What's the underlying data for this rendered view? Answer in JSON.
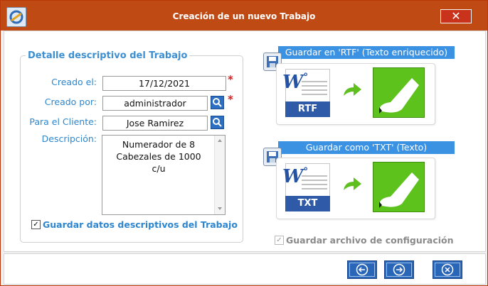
{
  "window": {
    "title": "Creación de un nuevo Trabajo",
    "close_glyph": "✕"
  },
  "details": {
    "legend": "Detalle descriptivo del Trabajo",
    "created_on_label": "Creado el:",
    "created_on_value": "17/12/2021",
    "created_by_label": "Creado por:",
    "created_by_value": "administrador",
    "client_label": "Para el Cliente:",
    "client_value": "Jose Ramirez",
    "description_label": "Descripción:",
    "description_value": "Numerador de 8\nCabezales de 1000\nc/u",
    "required_mark": "*",
    "save_details_label": "Guardar datos descriptivos del Trabajo",
    "save_details_checked": true
  },
  "export": {
    "rtf_header": "Guardar en 'RTF' (Texto enriquecido)",
    "rtf_label": "RTF",
    "txt_header": "Guardar como 'TXT' (Texto)",
    "txt_label": "TXT",
    "doc_glyph": "W",
    "doc_superscript": "°",
    "save_config_label": "Guardar archivo de configuración",
    "save_config_checked": true
  },
  "icons": {
    "app": "app-logo-icon",
    "lookup": "search-icon",
    "save": "floppy-disk-icon",
    "back": "arrow-left-icon",
    "next": "arrow-right-icon",
    "cancel": "x-circle-icon"
  },
  "colors": {
    "title_bar": "#c04a14",
    "label_blue": "#2d86cf",
    "header_blue": "#3b92e3",
    "button_blue": "#2a66b8",
    "required_red": "#d21f1f",
    "editor_green": "#5ec21c"
  }
}
